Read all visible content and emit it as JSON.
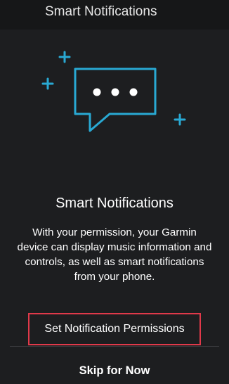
{
  "topbar": {
    "title": "Smart Notifications"
  },
  "colors": {
    "accent": "#29a9d3",
    "highlight_border": "#e0394a",
    "background": "#1d1e20"
  },
  "illustration": {
    "icon": "chat-bubble-icon",
    "decorations": "plus-icon"
  },
  "content": {
    "heading": "Smart Notifications",
    "body_lines": [
      "With your permission, your Garmin",
      "device can display music information and",
      "controls, as well as smart notifications",
      "from your phone."
    ]
  },
  "actions": {
    "set_permissions_label": "Set Notification Permissions",
    "skip_label": "Skip for Now"
  }
}
